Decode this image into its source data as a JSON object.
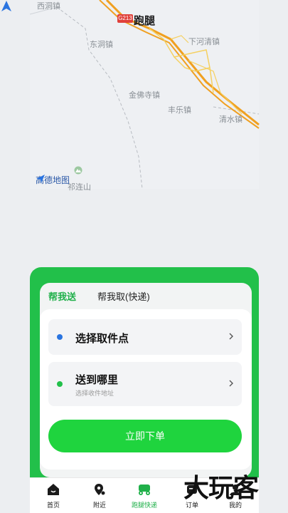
{
  "map": {
    "title": "跑腿",
    "highway_shield": "G213",
    "labels": {
      "xidong": "西洞镇",
      "dongdong": "东洞镇",
      "xiaheqing": "下河清镇",
      "jinfo": "金佛寺镇",
      "fengle": "丰乐镇",
      "qingshui": "清水镇",
      "qilianshan": "祁连山"
    },
    "logo": "高德地图",
    "colors": {
      "road_major": "#f0a020",
      "road_minor": "#f5d060",
      "river": "#c8cdd4"
    }
  },
  "tabs": {
    "send": "帮我送",
    "fetch": "帮我取(快递)"
  },
  "pickup": {
    "title": "选择取件点"
  },
  "delivery": {
    "title": "送到哪里",
    "subtitle": "选择收件地址"
  },
  "submit_label": "立即下单",
  "nav": {
    "home": "首页",
    "nearby": "附近",
    "errand": "跑腿快递",
    "orders": "订单",
    "mine": "我的"
  },
  "watermark": "大玩客",
  "colors": {
    "accent": "#22c04a",
    "button": "#1fd43e",
    "pickup_dot": "#2a74e0"
  }
}
